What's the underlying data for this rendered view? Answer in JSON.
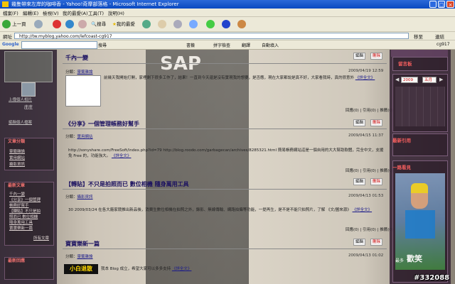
{
  "window": {
    "title": "幾隻帶來左岸的咖啡香 - Yahoo!奇摩部落格 - Microsoft Internet Explorer"
  },
  "menu": [
    "檔案(F)",
    "編輯(E)",
    "檢視(V)",
    "我的最愛(A)",
    "工具(T)",
    "說明(H)"
  ],
  "toolbar": {
    "back": "上一頁",
    "search": "搜尋",
    "favorites": "我的最愛"
  },
  "address": {
    "label": "網址",
    "url": "http://tw.myblog.yahoo.com/lefcoast-cg917",
    "go": "移至",
    "links": "連結"
  },
  "googlebar": {
    "logo": "Google",
    "search": "搜尋",
    "bookmarks": "書籤",
    "spell": "拼字檢查",
    "translate": "翻譯",
    "autofill": "自動填入",
    "user": "cg917"
  },
  "sidebar_left": {
    "upload_link": "上傳個人相片",
    "name": "庄庄",
    "profile_link": "編輯個人檔案",
    "categories_title": "文章分類",
    "categories": [
      "靈籤雜論",
      "實用網站",
      "攝影資訊"
    ],
    "recent_title": "最新文章",
    "recent": [
      "千內一變",
      "《分享》一個管理",
      "帳務好幫手",
      "【轉貼】不只是拍",
      "照而已 數位相機",
      "隨身萬用工具",
      "寶寶樂新一篇"
    ],
    "more": "所有文章",
    "reply_title": "最新回應"
  },
  "posts": [
    {
      "title": "千內一變",
      "category_label": "分類：",
      "category": "靈籤雜論",
      "date": "2009/04/19 12:59",
      "edit": "編輯",
      "delete": "刪除",
      "body": "前幾天我開始打開，家裡剩下很多工作了，結果！一直到今天還是沒有實現我的想要，是否應，現在大家都說是真不好，大家看我時，真的很意外",
      "more": "《詳全文》"
    },
    {
      "title": "《分享》一個管理帳務好幫手",
      "category_label": "分類：",
      "category": "實用網站",
      "date": "2009/04/15 11:37",
      "edit": "編輯",
      "delete": "刪除",
      "body": "http://sonyshare.com/FreeSoft/index.php?id=79   http://blog.roodo.com/garbagecan/archives/8285321.html  簡易帳務網站這是一個自用的大大幫助軟體，完全中文，支援免 Free 的，功能強大。",
      "more": "《詳全文》",
      "meta": "回應(0) | 引用(0) | 推薦(0)"
    },
    {
      "title": "【轉貼】不只是拍照而已 數位相機 隨身萬用工具",
      "category_label": "分類：",
      "category": "攝影資訊",
      "date": "2009/04/13 01:53",
      "edit": "編輯",
      "delete": "刪除",
      "body": "30 2009/03/24 在各大廠家競推出新品後，消費生數位相機在拍照之外，錄影、無線傳輸、網路拍攝等功能，一提再生，是不是不能只拍照片，了解 《文/圖來源》",
      "more": "《詳全文》",
      "meta": "回應(0) | 引用(0) | 推薦(0)"
    },
    {
      "title": "寶寶樂新一篇",
      "category_label": "分類：",
      "category": "靈籤雜論",
      "date": "2009/04/13 01:02",
      "edit": "編輯",
      "delete": "刪除",
      "badge": "小白退散",
      "body": "我本 Blog 成立，希望大家可以多多支持",
      "more": "《詳全文》"
    }
  ],
  "top_meta": "回應(0) | 引用(0) | 推薦(0)",
  "sidebar_right": {
    "calendar_title": "留言板",
    "year": "2009",
    "month": "五月",
    "latest_title": "最新引用",
    "photo_title": "一路看見",
    "photo_caption": "最多",
    "photo_text": "歡笑"
  },
  "watermark": "#332088"
}
